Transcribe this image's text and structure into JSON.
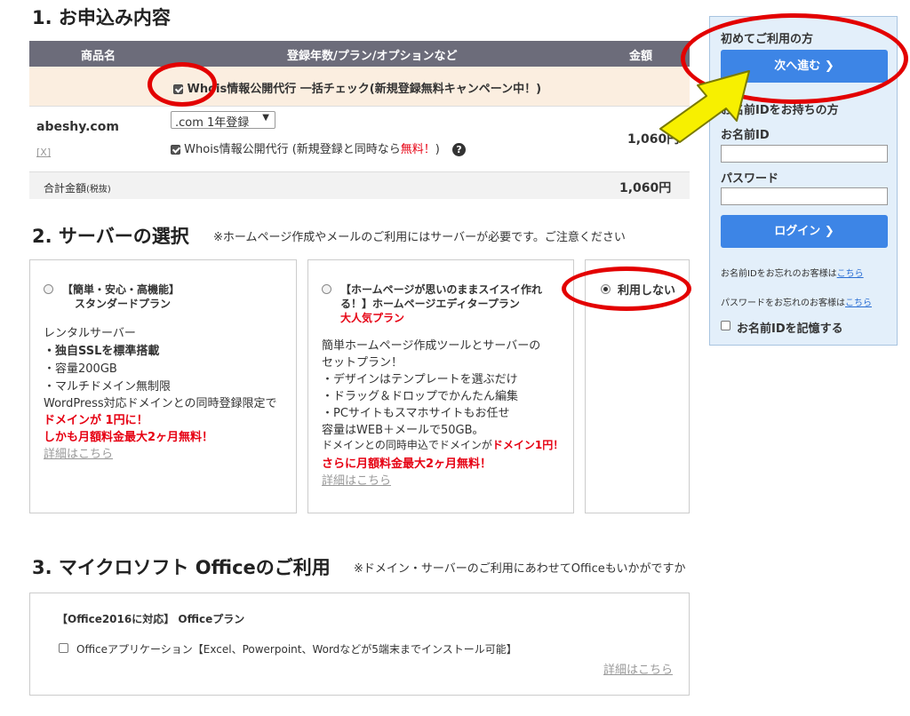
{
  "section1": {
    "title": "1. お申込み内容",
    "table": {
      "headers": [
        "商品名",
        "登録年数/プラン/オプションなど",
        "金額"
      ],
      "bulk_check_label": "Whois情報公開代行 一括チェック(新規登録無料キャンペーン中！)",
      "item": {
        "domain": "abeshy.com",
        "remove": "[X]",
        "select_value": ".com 1年登録",
        "whois_label_prefix": "Whois情報公開代行 (新規登録と同時なら",
        "whois_label_free": "無料！",
        "whois_label_suffix": ")",
        "price": "1,060円"
      },
      "total_label": "合計金額",
      "total_tax": "(税抜)",
      "total_price": "1,060円"
    }
  },
  "section2": {
    "title": "2. サーバーの選択",
    "note": "※ホームページ作成やメールのご利用にはサーバーが必要です。ご注意ください",
    "standard": {
      "label1": "【簡単・安心・高機能】",
      "label2": "スタンダードプラン",
      "lines": [
        "レンタルサーバー",
        "・独自SSLを標準搭載",
        "・容量200GB",
        "・マルチドメイン無制限",
        "WordPress対応ドメインとの同時登録限定で"
      ],
      "red1": "ドメインが 1円に！",
      "red2": "しかも月額料金最大2ヶ月無料！",
      "link": "詳細はこちら"
    },
    "editor": {
      "label1": "【ホームページが思いのままスイスイ作れ",
      "label2": "る！】ホームページエディタープラン",
      "popular": "大人気プラン",
      "lines": [
        "簡単ホームページ作成ツールとサーバーの",
        "セットプラン！",
        "・デザインはテンプレートを選ぶだけ",
        "・ドラッグ＆ドロップでかんたん編集",
        "・PCサイトもスマホサイトもお任せ",
        "容量はWEB＋メールで50GB。"
      ],
      "mix_prefix": "ドメインとの同時申込でドメインが",
      "mix_red": "ドメイン1円！",
      "red2": "さらに月額料金最大2ヶ月無料！",
      "link": "詳細はこちら"
    },
    "none": {
      "label": "利用しない"
    }
  },
  "section3": {
    "title": "3. マイクロソフト Officeのご利用",
    "note": "※ドメイン・サーバーのご利用にあわせてOfficeもいかがですか",
    "plan_title": "【Office2016に対応】 Officeプラン",
    "app_label": "Officeアプリケーション【Excel、Powerpoint、Wordなどが5端末までインストール可能】",
    "link": "詳細はこちら"
  },
  "sidebar": {
    "first_time": "初めてご利用の方",
    "next_button": "次へ進む",
    "members": "お名前IDをお持ちの方",
    "id_label": "お名前ID",
    "password_label": "パスワード",
    "login_button": "ログイン",
    "forgot_id_prefix": "お名前IDをお忘れのお客様は",
    "forgot_id_link": "こちら",
    "forgot_pw_prefix": "パスワードをお忘れのお客様は",
    "forgot_pw_link": "こちら",
    "remember_label": "お名前IDを記憶する"
  },
  "colors": {
    "annotation": "#e30000",
    "arrow": "#f7f000",
    "header_bg": "#6c6c7a",
    "button_blue": "#3d85e6"
  }
}
